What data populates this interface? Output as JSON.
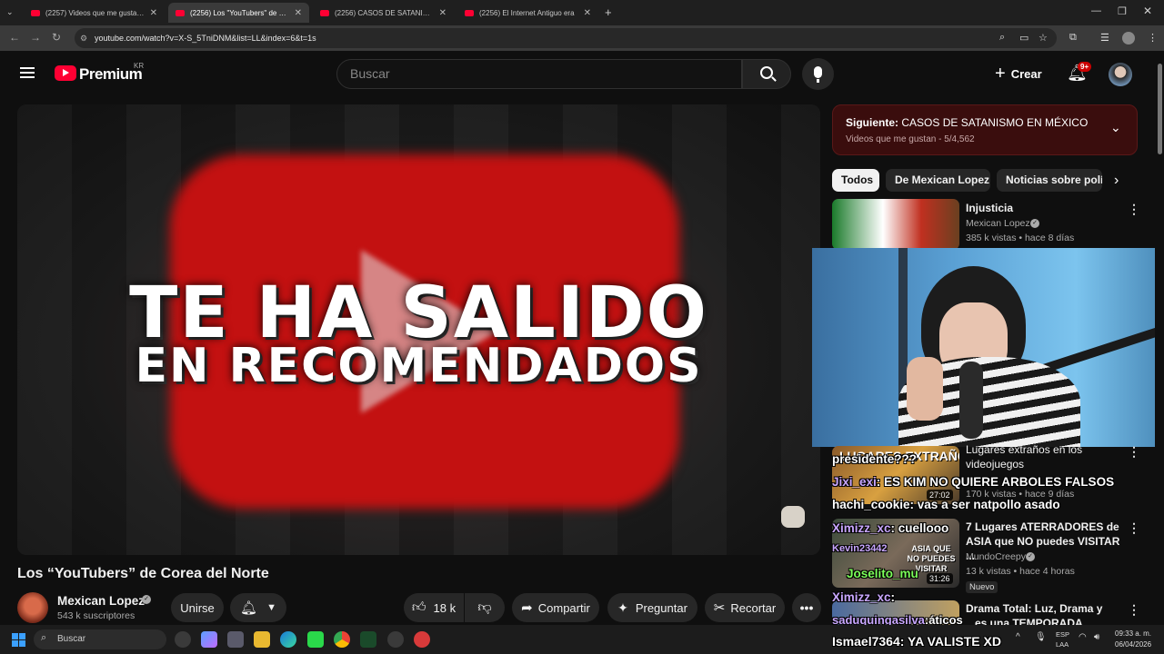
{
  "browser": {
    "tabs": [
      {
        "title": "(2257) Videos que me gustan -"
      },
      {
        "title": "(2256) Los \"YouTubers\" de Core"
      },
      {
        "title": "(2256) CASOS DE SATANISMO"
      },
      {
        "title": "(2256) El Internet Antiguo era"
      }
    ],
    "url": "youtube.com/watch?v=X-S_5TniDNM&list=LL&index=6&t=1s"
  },
  "header": {
    "logo": "Premium",
    "region": "KR",
    "search_placeholder": "Buscar",
    "create_label": "Crear",
    "notif_badge": "9+"
  },
  "video": {
    "overlay_line1": "TE HA SALIDO",
    "overlay_line2": "EN RECOMENDADOS",
    "title": "Los “YouTubers” de Corea del Norte",
    "channel": "Mexican Lopez",
    "subscribers": "543 k suscriptores",
    "join_label": "Unirse",
    "likes": "18 k",
    "share_label": "Compartir",
    "ask_label": "Preguntar",
    "clip_label": "Recortar"
  },
  "playlist": {
    "next_prefix": "Siguiente:",
    "next_title": "CASOS DE SATANISMO EN MÉXICO",
    "subtitle": "Videos que me gustan - 5/4,562"
  },
  "chips": [
    "Todos",
    "De Mexican Lopez",
    "Noticias sobre polí"
  ],
  "related": [
    {
      "title": "Injusticia",
      "channel": "Mexican Lopez",
      "meta": "385 k vistas • hace 8 días"
    },
    {
      "title": "Lugares extraños en los videojuegos",
      "meta": "170 k vistas • hace 9 días",
      "duration": "27:02",
      "thumb_text": "LUGARES EXTRAÑOS"
    },
    {
      "title": "7 Lugares ATERRADORES de ASIA que NO puedes VISITAR ...",
      "channel": "MundoCreepy",
      "meta": "13 k vistas • hace 4 horas",
      "badge": "Nuevo",
      "duration": "31:26",
      "thumb_text": "ASIA QUE NO PUEDES VISITAR"
    },
    {
      "title": "Drama Total: Luz, Drama y ...es una TEMPORADA"
    }
  ],
  "chat": [
    {
      "user": "",
      "text": "presidente???"
    },
    {
      "user": "Jixi_exi",
      "text": ": ES KIM NO QUIERE ARBOLES FALSOS"
    },
    {
      "user": "hachi_cookie",
      "text": ": vas a ser natpollo asado"
    },
    {
      "user": "Ximizz_xc",
      "text": ": cuellooo"
    },
    {
      "user": "Kevin23442",
      "text": ""
    },
    {
      "user": "Joselito_mu",
      "text": ""
    },
    {
      "user": "Ximizz_xc",
      "text": ":"
    },
    {
      "user": "saduquingasilva",
      "text": ":áticos"
    },
    {
      "user": "Ismael7364",
      "text": ": YA VALISTE XD"
    }
  ],
  "taskbar": {
    "search_placeholder": "Buscar",
    "lang1": "ESP",
    "lang2": "LAA",
    "time": "09:33 a. m.",
    "date": "06/04/2026"
  },
  "colors": {
    "yt_red": "#ff0033",
    "bg": "#0f0f0f",
    "chip_bg": "#272727"
  }
}
